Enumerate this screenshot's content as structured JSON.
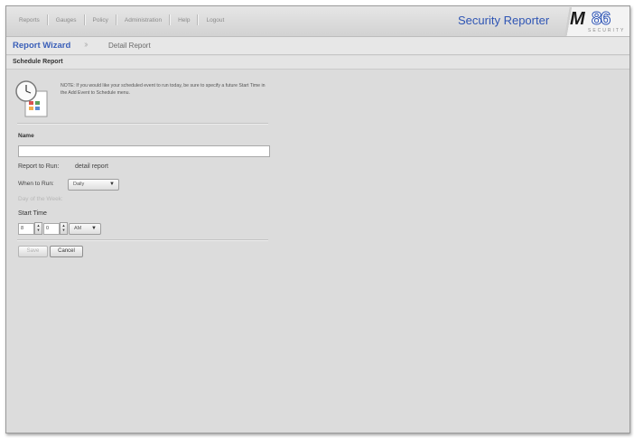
{
  "nav": {
    "items": [
      "Reports",
      "Gauges",
      "Policy",
      "Administration",
      "Help",
      "Logout"
    ],
    "app_title": "Security Reporter"
  },
  "logo": {
    "mark_m": "M",
    "mark_86": "86",
    "subtitle": "SECURITY"
  },
  "breadcrumb": {
    "wizard": "Report Wizard",
    "current": "Detail Report"
  },
  "section": {
    "title": "Schedule Report"
  },
  "form": {
    "note": "NOTE: If you would like your scheduled event to run today, be sure to specify a future Start Time in the Add Event to Schedule menu.",
    "name_label": "Name",
    "name_value": "",
    "report_to_run_label": "Report to Run:",
    "report_to_run_value": "detail report",
    "when_to_run_label": "When to Run:",
    "when_to_run_value": "Daily",
    "day_of_week_label": "Day of the Week:",
    "start_time_label": "Start Time",
    "hour_value": "8",
    "minute_value": "0",
    "ampm_value": "AM",
    "save_label": "Save",
    "cancel_label": "Cancel"
  },
  "colors": {
    "accent": "#3a5fb8",
    "background": "#dcdcdc"
  },
  "icons": {
    "schedule": "clock-calendar-icon",
    "dropdown": "chevron-down-icon",
    "spinner": "spinner-arrows-icon"
  }
}
